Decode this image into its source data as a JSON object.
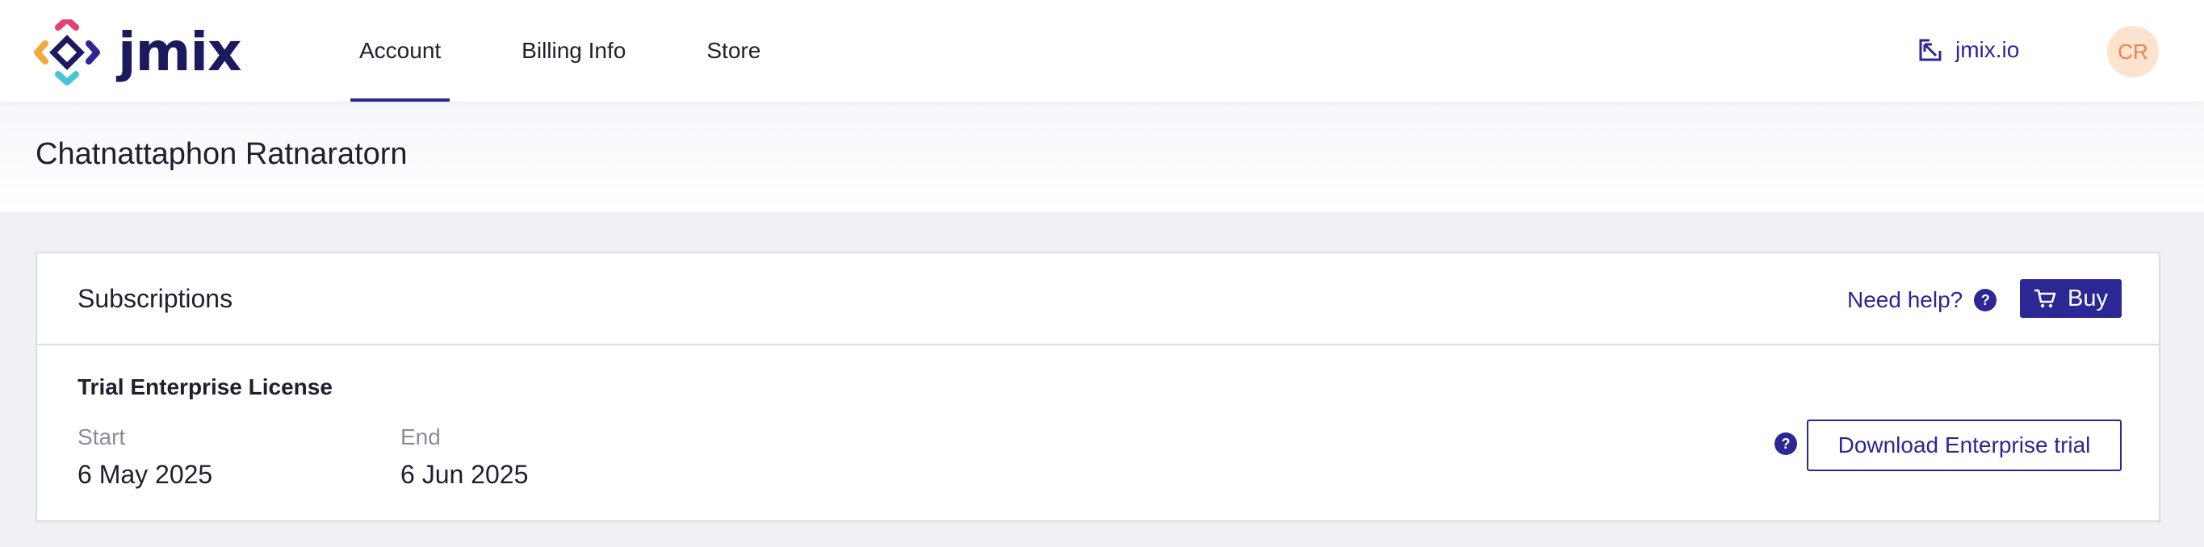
{
  "brand": {
    "name": "jmix",
    "accent": "#2b2794"
  },
  "nav": {
    "items": [
      {
        "label": "Account",
        "active": true
      },
      {
        "label": "Billing Info",
        "active": false
      },
      {
        "label": "Store",
        "active": false
      }
    ],
    "external_link": {
      "label": "jmix.io",
      "icon": "external-link-icon"
    },
    "avatar_initials": "CR"
  },
  "page": {
    "title": "Chatnattaphon Ratnaratorn"
  },
  "subscriptions": {
    "title": "Subscriptions",
    "help_label": "Need help?",
    "help_icon": "?",
    "buy_label": "Buy",
    "buy_icon": "cart-icon",
    "license": {
      "name": "Trial Enterprise License",
      "start_label": "Start",
      "start_value": "6 May 2025",
      "end_label": "End",
      "end_value": "6 Jun 2025",
      "download_help_icon": "?",
      "download_label": "Download Enterprise trial"
    }
  }
}
